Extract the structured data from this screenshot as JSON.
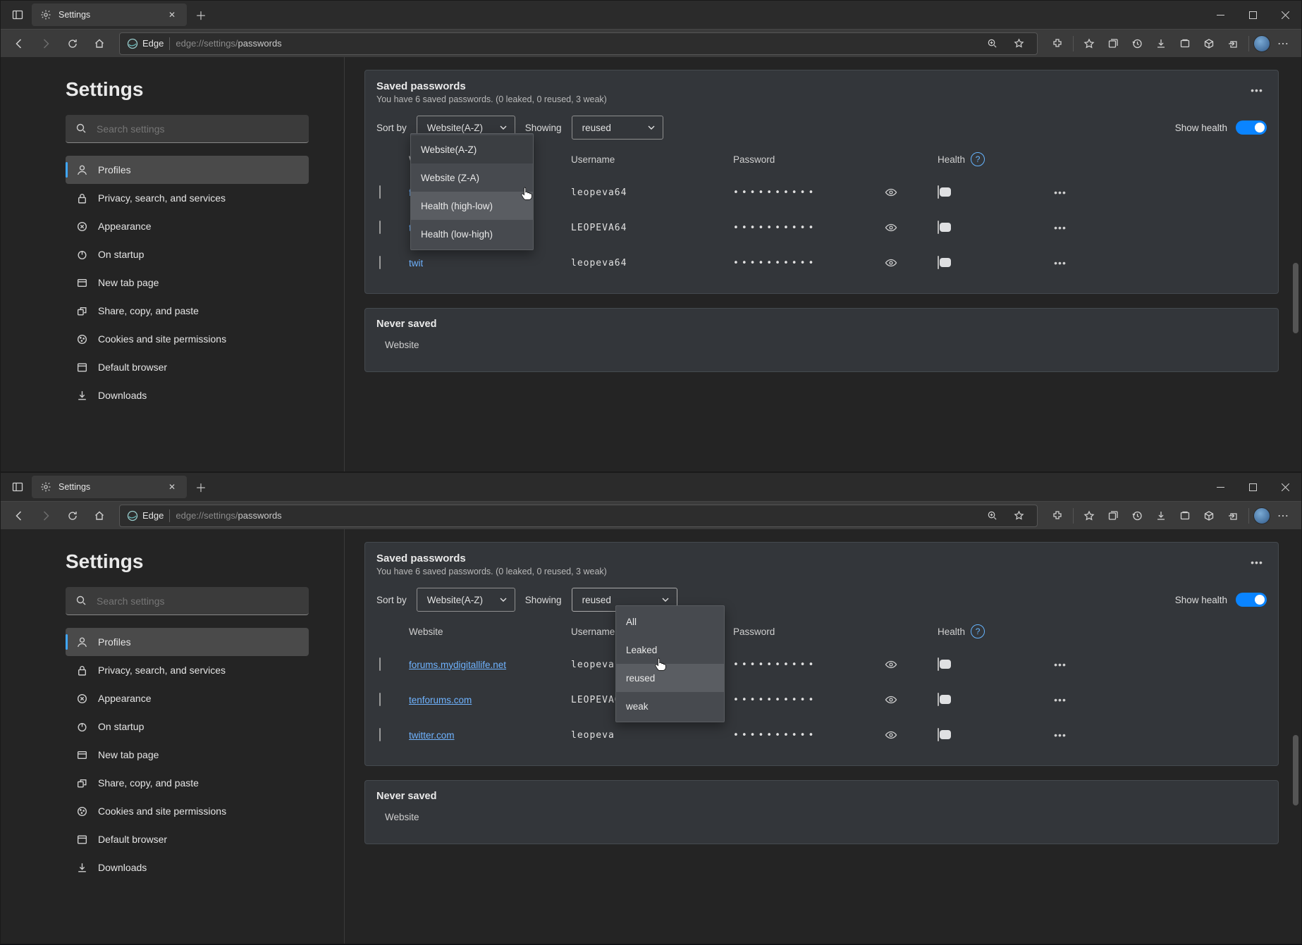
{
  "tab": {
    "title": "Settings"
  },
  "addr": {
    "edge_label": "Edge",
    "url_prefix": "edge://settings/",
    "url_page": "passwords"
  },
  "sidebar": {
    "heading": "Settings",
    "search_ph": "Search settings",
    "items": [
      {
        "icon": "user",
        "label": "Profiles",
        "active": true
      },
      {
        "icon": "lock",
        "label": "Privacy, search, and services"
      },
      {
        "icon": "paint",
        "label": "Appearance"
      },
      {
        "icon": "power",
        "label": "On startup"
      },
      {
        "icon": "tab",
        "label": "New tab page"
      },
      {
        "icon": "share",
        "label": "Share, copy, and paste"
      },
      {
        "icon": "cookie",
        "label": "Cookies and site permissions"
      },
      {
        "icon": "browser",
        "label": "Default browser"
      },
      {
        "icon": "download",
        "label": "Downloads"
      }
    ]
  },
  "saved": {
    "title": "Saved passwords",
    "sub": "You have 6 saved passwords. (0 leaked, 0 reused, 3 weak)",
    "sort_label": "Sort by",
    "sort_value": "Website(A-Z)",
    "sort_options": [
      "Website(A-Z)",
      "Website (Z-A)",
      "Health (high-low)",
      "Health (low-high)"
    ],
    "show_label": "Showing",
    "show_value": "reused",
    "show_options": [
      "All",
      "Leaked",
      "reused",
      "weak"
    ],
    "showhealth_label": "Show health",
    "cols": {
      "website": "Website",
      "user": "Username",
      "pw": "Password",
      "health": "Health"
    },
    "rows": [
      {
        "site": "forums.mydigitallife.net",
        "user": "leopeva64"
      },
      {
        "site": "tenforums.com",
        "user": "LEOPEVA64"
      },
      {
        "site": "twitter.com",
        "user": "leopeva64"
      }
    ]
  },
  "never": {
    "title": "Never saved",
    "col": "Website"
  }
}
